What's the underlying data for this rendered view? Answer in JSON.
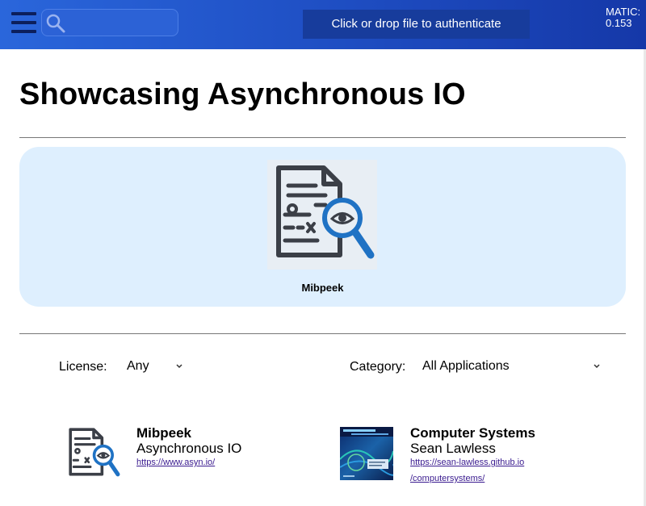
{
  "header": {
    "search_placeholder": "",
    "auth_label": "Click or drop file to authenticate",
    "balance_currency": "MATIC:",
    "balance_value": "0.153"
  },
  "page_title": "Showcasing Asynchronous IO",
  "featured": {
    "caption": "Mibpeek",
    "icon": "document-magnifier-icon"
  },
  "filters": {
    "license_label": "License:",
    "license_value": "Any",
    "category_label": "Category:",
    "category_value": "All Applications"
  },
  "apps": [
    {
      "name": "Mibpeek",
      "subtitle": "Asynchronous IO",
      "link": "https://www.asyn.io/",
      "icon": "document-magnifier-icon"
    },
    {
      "name": "Computer Systems",
      "subtitle": "Sean Lawless",
      "link_line1": "https://sean-lawless.github.io",
      "link_line2": "/computersystems/",
      "icon": "book-cover-thumbnail"
    }
  ],
  "colors": {
    "header_start": "#2a66db",
    "header_end": "#1538a8",
    "auth_button": "#173c9c",
    "hero_background": "#deeffe",
    "icon_dark": "#3b3f47",
    "icon_blue": "#1f72c4",
    "link": "#3a1b8f"
  }
}
